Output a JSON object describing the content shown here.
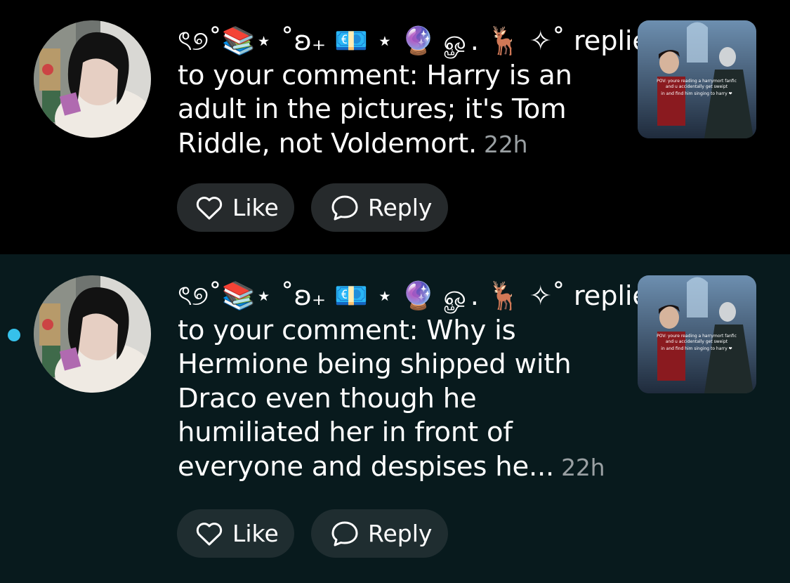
{
  "notifications": [
    {
      "username": "ৎ୭˚📚⋆ ˚ʚ₊ 💶 ⋆ 🔮 ௐ. 🦌 ✧˚",
      "action": "replied",
      "lines": [
        "to your comment: Harry is an",
        "adult in the pictures; it's Tom",
        "Riddle, not Voldemort."
      ],
      "time": "22h",
      "unread": false,
      "like_label": "Like",
      "reply_label": "Reply",
      "thumb_caption": "POV: youre reading a harrymort fanfic and u accidentally get sweipt in and find him singing to harry"
    },
    {
      "username": "ৎ୭˚📚⋆ ˚ʚ₊ 💶 ⋆ 🔮 ௐ. 🦌 ✧˚",
      "action": "replied",
      "lines": [
        "to your comment: Why is",
        "Hermione being shipped with",
        "Draco even though he",
        "humiliated her in front of",
        "everyone and despises he..."
      ],
      "time": "22h",
      "unread": true,
      "like_label": "Like",
      "reply_label": "Reply",
      "thumb_caption": "POV: youre reading a harrymort fanfic and u accidentally get sweipt in and find him singing to harry"
    }
  ],
  "colors": {
    "background": "#000000",
    "unread_background": "#081a1d",
    "unread_dot": "#36c1ea",
    "timestamp": "#9aa0a3"
  },
  "icons": [
    "heart-icon",
    "comment-bubble-icon"
  ]
}
